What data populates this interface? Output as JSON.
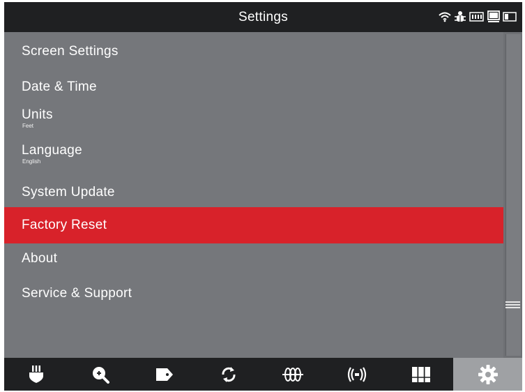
{
  "header": {
    "title": "Settings",
    "status_icons": [
      "wifi-icon",
      "bug-icon",
      "battery-icon",
      "monitor-icon",
      "window-icon"
    ]
  },
  "menu": {
    "items": [
      {
        "label": "Screen Settings",
        "sub": ""
      },
      {
        "label": "Date & Time",
        "sub": ""
      },
      {
        "label": "Units",
        "sub": "Feet"
      },
      {
        "label": "Language",
        "sub": "English"
      },
      {
        "label": "System Update",
        "sub": ""
      },
      {
        "label": "Factory Reset",
        "sub": "",
        "selected": true
      },
      {
        "label": "About",
        "sub": ""
      },
      {
        "label": "Service & Support",
        "sub": ""
      }
    ]
  },
  "toolbar": {
    "tools": [
      "probe-icon",
      "zoom-in-icon",
      "tag-icon",
      "refresh-icon",
      "coil-icon",
      "signal-icon",
      "grid-icon",
      "gear-icon"
    ],
    "active": "gear-icon"
  },
  "colors": {
    "background": "#75777b",
    "bar": "#1f2022",
    "selected": "#d8222a",
    "text": "#ffffff",
    "active_tool": "#9fa1a4"
  }
}
